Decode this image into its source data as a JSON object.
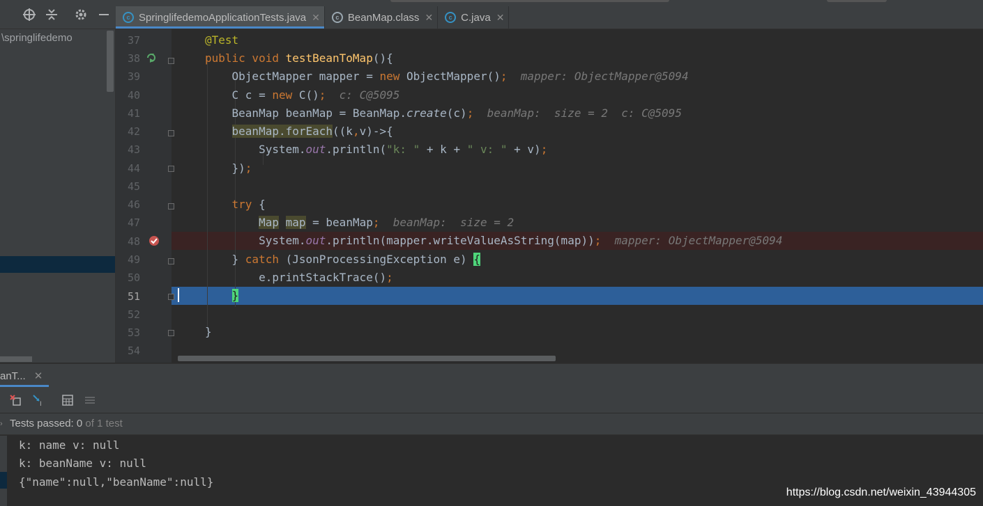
{
  "project": {
    "path_label": "\\springlifedemo"
  },
  "tabs": [
    {
      "label": "SpringlifedemoApplicationTests.java",
      "icon": "java-class-test-icon",
      "active": true
    },
    {
      "label": "BeanMap.class",
      "icon": "class-file-icon",
      "active": false
    },
    {
      "label": "C.java",
      "icon": "java-class-icon",
      "active": false
    }
  ],
  "editor": {
    "line_numbers": [
      "37",
      "38",
      "39",
      "40",
      "41",
      "42",
      "43",
      "44",
      "45",
      "46",
      "47",
      "48",
      "49",
      "50",
      "51",
      "52",
      "53",
      "54"
    ],
    "current_line": "51",
    "breakpoint_line": "48",
    "hints": {
      "l39": "mapper: ObjectMapper@5094",
      "l40": "c: C@5095",
      "l41": "beanMap:  size = 2  c: C@5095",
      "l47": "beanMap:  size = 2",
      "l48": "mapper: ObjectMapper@5094"
    }
  },
  "run": {
    "tab_label": "anT...",
    "status_prefix": "Tests passed: ",
    "status_count": "0",
    "status_suffix": " of 1 test",
    "console": [
      "k: name v: null",
      "k: beanName v: null",
      "{\"name\":null,\"beanName\":null}"
    ]
  },
  "watermark": "https://blog.csdn.net/weixin_43944305",
  "colors": {
    "background": "#2b2b2b",
    "panel": "#3c3f41",
    "keyword": "#cc7832",
    "annotation": "#bbb529",
    "method": "#ffc66d",
    "string": "#6a8759",
    "static_field": "#9876aa",
    "selection": "#2d5f99",
    "breakpoint": "#c75450"
  }
}
